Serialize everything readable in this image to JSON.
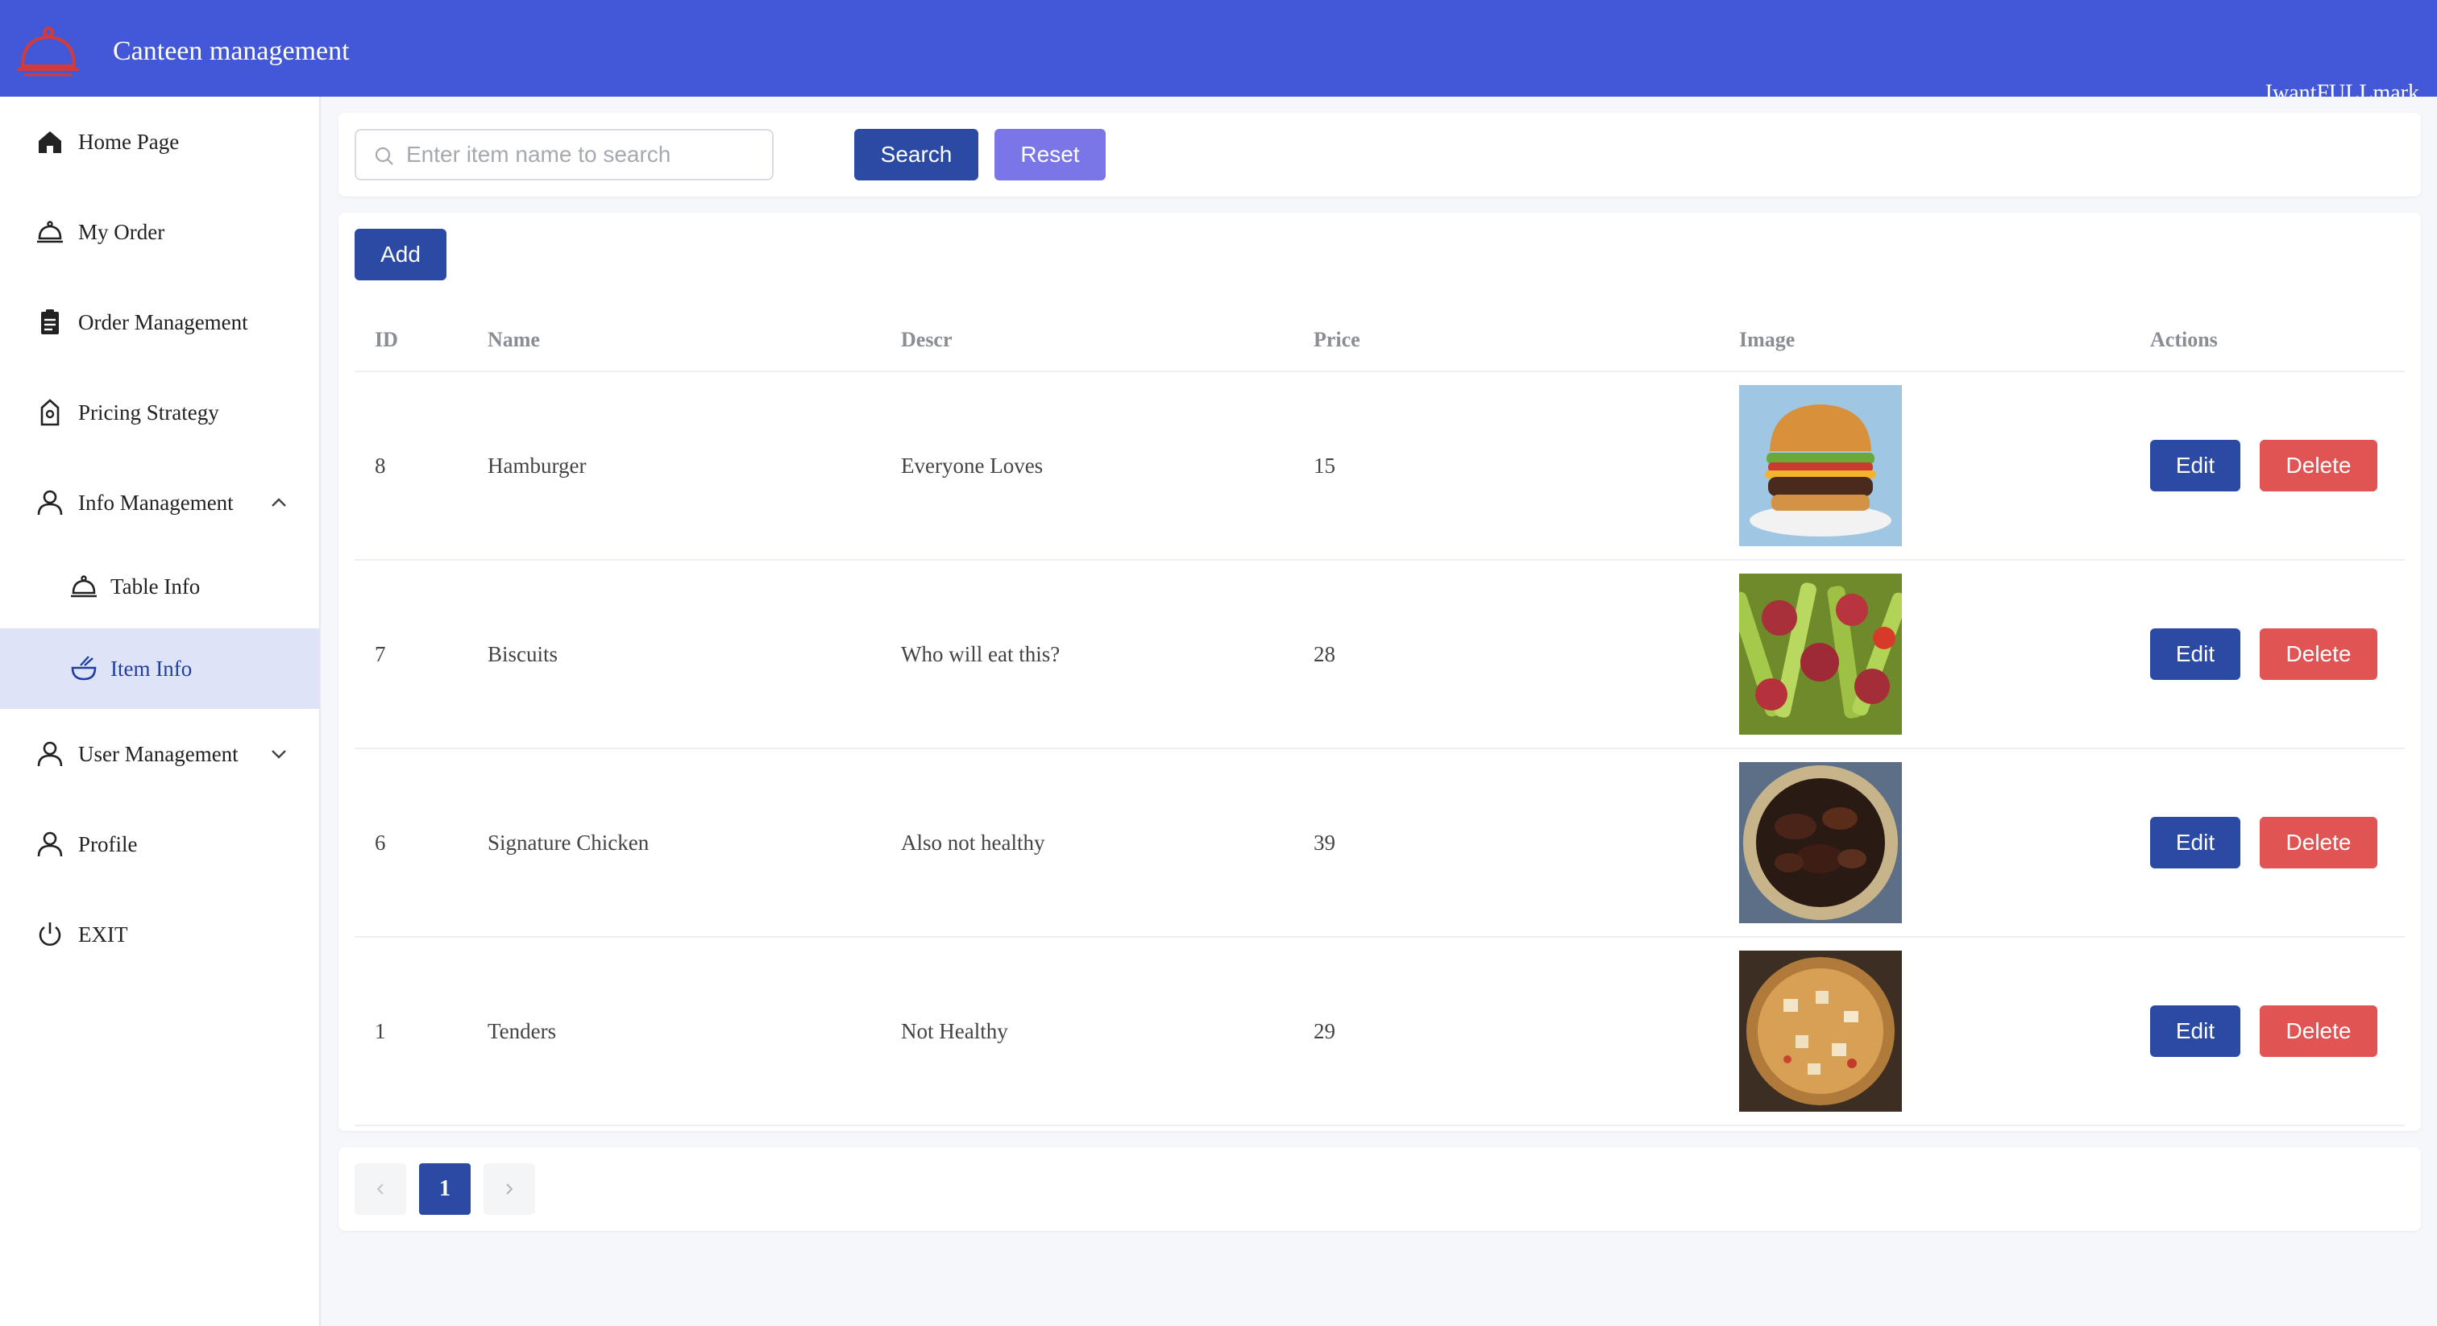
{
  "header": {
    "app_title": "Canteen management",
    "user_mark": "IwantFULLmark"
  },
  "colors": {
    "header": "#4358d6",
    "primary_button": "#2a4aa3",
    "reset_button": "#7b76e8",
    "delete_button": "#e05454",
    "active_menu": "#dfe3f8"
  },
  "sidebar": {
    "items": [
      {
        "label": "Home Page",
        "icon": "home-icon"
      },
      {
        "label": "My Order",
        "icon": "cloche-icon"
      },
      {
        "label": "Order Management",
        "icon": "clipboard-icon"
      },
      {
        "label": "Pricing Strategy",
        "icon": "price-tag-icon"
      },
      {
        "label": "Info Management",
        "icon": "user-icon",
        "expanded": true
      },
      {
        "label": "Table Info",
        "icon": "cloche-icon"
      },
      {
        "label": "Item Info",
        "icon": "bowl-icon",
        "active": true
      },
      {
        "label": "User Management",
        "icon": "user-icon",
        "expanded": false
      },
      {
        "label": "Profile",
        "icon": "user-icon"
      },
      {
        "label": "EXIT",
        "icon": "power-icon"
      }
    ]
  },
  "search": {
    "placeholder": "Enter item name to search",
    "value": "",
    "search_label": "Search",
    "reset_label": "Reset"
  },
  "table": {
    "add_label": "Add",
    "columns": [
      "ID",
      "Name",
      "Descr",
      "Price",
      "Image",
      "Actions"
    ],
    "edit_label": "Edit",
    "delete_label": "Delete",
    "rows": [
      {
        "id": "8",
        "name": "Hamburger",
        "descr": "Everyone Loves",
        "price": "15",
        "image": "hamburger"
      },
      {
        "id": "7",
        "name": "Biscuits",
        "descr": "Who will eat this?",
        "price": "28",
        "image": "stir-fried celery and sausage"
      },
      {
        "id": "6",
        "name": "Signature Chicken",
        "descr": "Also not healthy",
        "price": "39",
        "image": "glazed chicken"
      },
      {
        "id": "1",
        "name": "Tenders",
        "descr": "Not Healthy",
        "price": "29",
        "image": "tofu stew"
      }
    ]
  },
  "pagination": {
    "current_page": "1"
  }
}
